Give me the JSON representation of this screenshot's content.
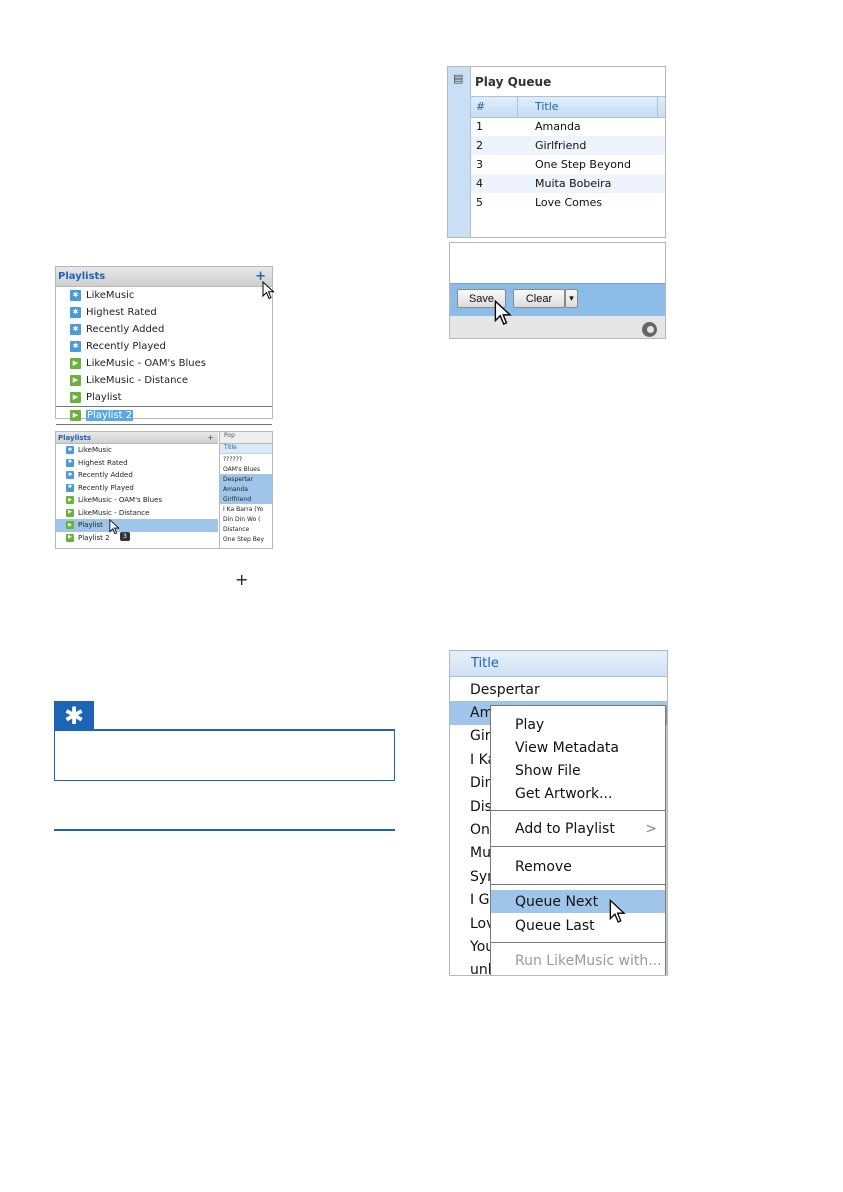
{
  "playlists_panel": {
    "header": "Playlists",
    "add_symbol": "+",
    "items": [
      {
        "label": "LikeMusic",
        "icon": "blue"
      },
      {
        "label": "Highest Rated",
        "icon": "blue"
      },
      {
        "label": "Recently Added",
        "icon": "blue"
      },
      {
        "label": "Recently Played",
        "icon": "blue"
      },
      {
        "label": "LikeMusic - OAM's Blues",
        "icon": "green"
      },
      {
        "label": "LikeMusic - Distance",
        "icon": "green"
      },
      {
        "label": "Playlist",
        "icon": "green"
      },
      {
        "label": "Playlist 2",
        "icon": "green"
      }
    ]
  },
  "drag_panel": {
    "header": "Playlists",
    "add_symbol": "+",
    "right_header": "Pop",
    "right_title": "Title",
    "drag_count": "3",
    "items": [
      {
        "label": "LikeMusic"
      },
      {
        "label": "Highest Rated"
      },
      {
        "label": "Recently Added"
      },
      {
        "label": "Recently Played"
      },
      {
        "label": "LikeMusic - OAM's Blues"
      },
      {
        "label": "LikeMusic - Distance"
      },
      {
        "label": "Playlist"
      },
      {
        "label": "Playlist 2"
      }
    ],
    "tracks": [
      {
        "label": "??????",
        "selected": false
      },
      {
        "label": "OAM's Blues",
        "selected": false
      },
      {
        "label": "Despertar",
        "selected": true
      },
      {
        "label": "Amanda",
        "selected": true
      },
      {
        "label": "Girlfriend",
        "selected": true
      },
      {
        "label": "I Ka Barra (Yo",
        "selected": false
      },
      {
        "label": "Din Din Wo (",
        "selected": false
      },
      {
        "label": "Distance",
        "selected": false
      },
      {
        "label": "One Step Bey",
        "selected": false
      }
    ]
  },
  "plus_glyph": "+",
  "tip_icon": "✱",
  "play_queue": {
    "title": "Play Queue",
    "col_num": "#",
    "col_title": "Title",
    "rows": [
      {
        "num": "1",
        "title": "Amanda"
      },
      {
        "num": "2",
        "title": "Girlfriend"
      },
      {
        "num": "3",
        "title": "One Step Beyond"
      },
      {
        "num": "4",
        "title": "Muita Bobeira"
      },
      {
        "num": "5",
        "title": "Love Comes"
      }
    ],
    "save_label": "Save",
    "clear_label": "Clear",
    "dropdown_symbol": "▾"
  },
  "track_list": {
    "header": "Title",
    "rows": [
      "Despertar",
      "Amanda",
      "Girlfriend",
      "I Ka Barra",
      "Din Din Wo",
      "Distance",
      "One Step Beyond",
      "Muita Bobeira",
      "Synchro",
      "I Got",
      "Love Comes",
      "You",
      "unknown"
    ]
  },
  "context_menu": {
    "play": "Play",
    "view_metadata": "View Metadata",
    "show_file": "Show File",
    "get_artwork": "Get Artwork...",
    "add_to_playlist": "Add to Playlist",
    "submenu_arrow": ">",
    "remove": "Remove",
    "queue_next": "Queue Next",
    "queue_last": "Queue Last",
    "run_with": "Run LikeMusic with..."
  }
}
